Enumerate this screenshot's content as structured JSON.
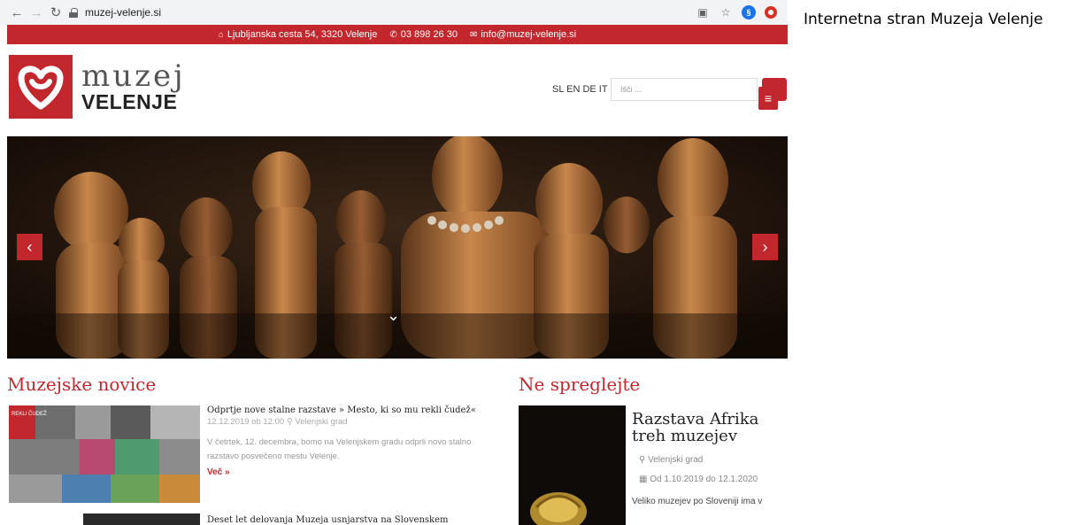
{
  "browser": {
    "url": "muzej-velenje.si",
    "nav_icons": [
      "back-icon",
      "forward-icon",
      "reload-icon"
    ],
    "ext_blue_label": "§"
  },
  "caption": "Internetna stran Muzeja Velenje",
  "topbar": {
    "address": "Ljubljanska cesta 54, 3320 Velenje",
    "phone": "03 898 26 30",
    "email": "info@muzej-velenje.si",
    "color": "#c1272d"
  },
  "header": {
    "logo_top": "muzej",
    "logo_bottom": "VELENJE",
    "languages": "SL EN DE IT",
    "search_placeholder": "Išči ..."
  },
  "news": {
    "title": "Muzejske novice",
    "items": [
      {
        "headline": "Odprtje nove stalne razstave » Mesto, ki so mu rekli čudež«",
        "date": "12.12.2019 ob 12:00",
        "location": "Velenjski grad",
        "text": "V četrtek, 12. decembra, bomo na Velenjskem gradu odprli novo stalno razstavo posvečeno mestu Velenje.",
        "more": "Več »",
        "thumb_label": "REKLI ČUDEŽ"
      },
      {
        "headline": "Deset let delovanja Muzeja usnjarstva na Slovenskem"
      }
    ]
  },
  "featured": {
    "title": "Ne spreglejte",
    "item_title": "Razstava Afrika treh muzejev",
    "location": "Velenjski grad",
    "dates": "Od 1.10.2019 do 12.1.2020",
    "text": "Veliko muzejev po Sloveniji ima v"
  },
  "accent": "#c1272d"
}
